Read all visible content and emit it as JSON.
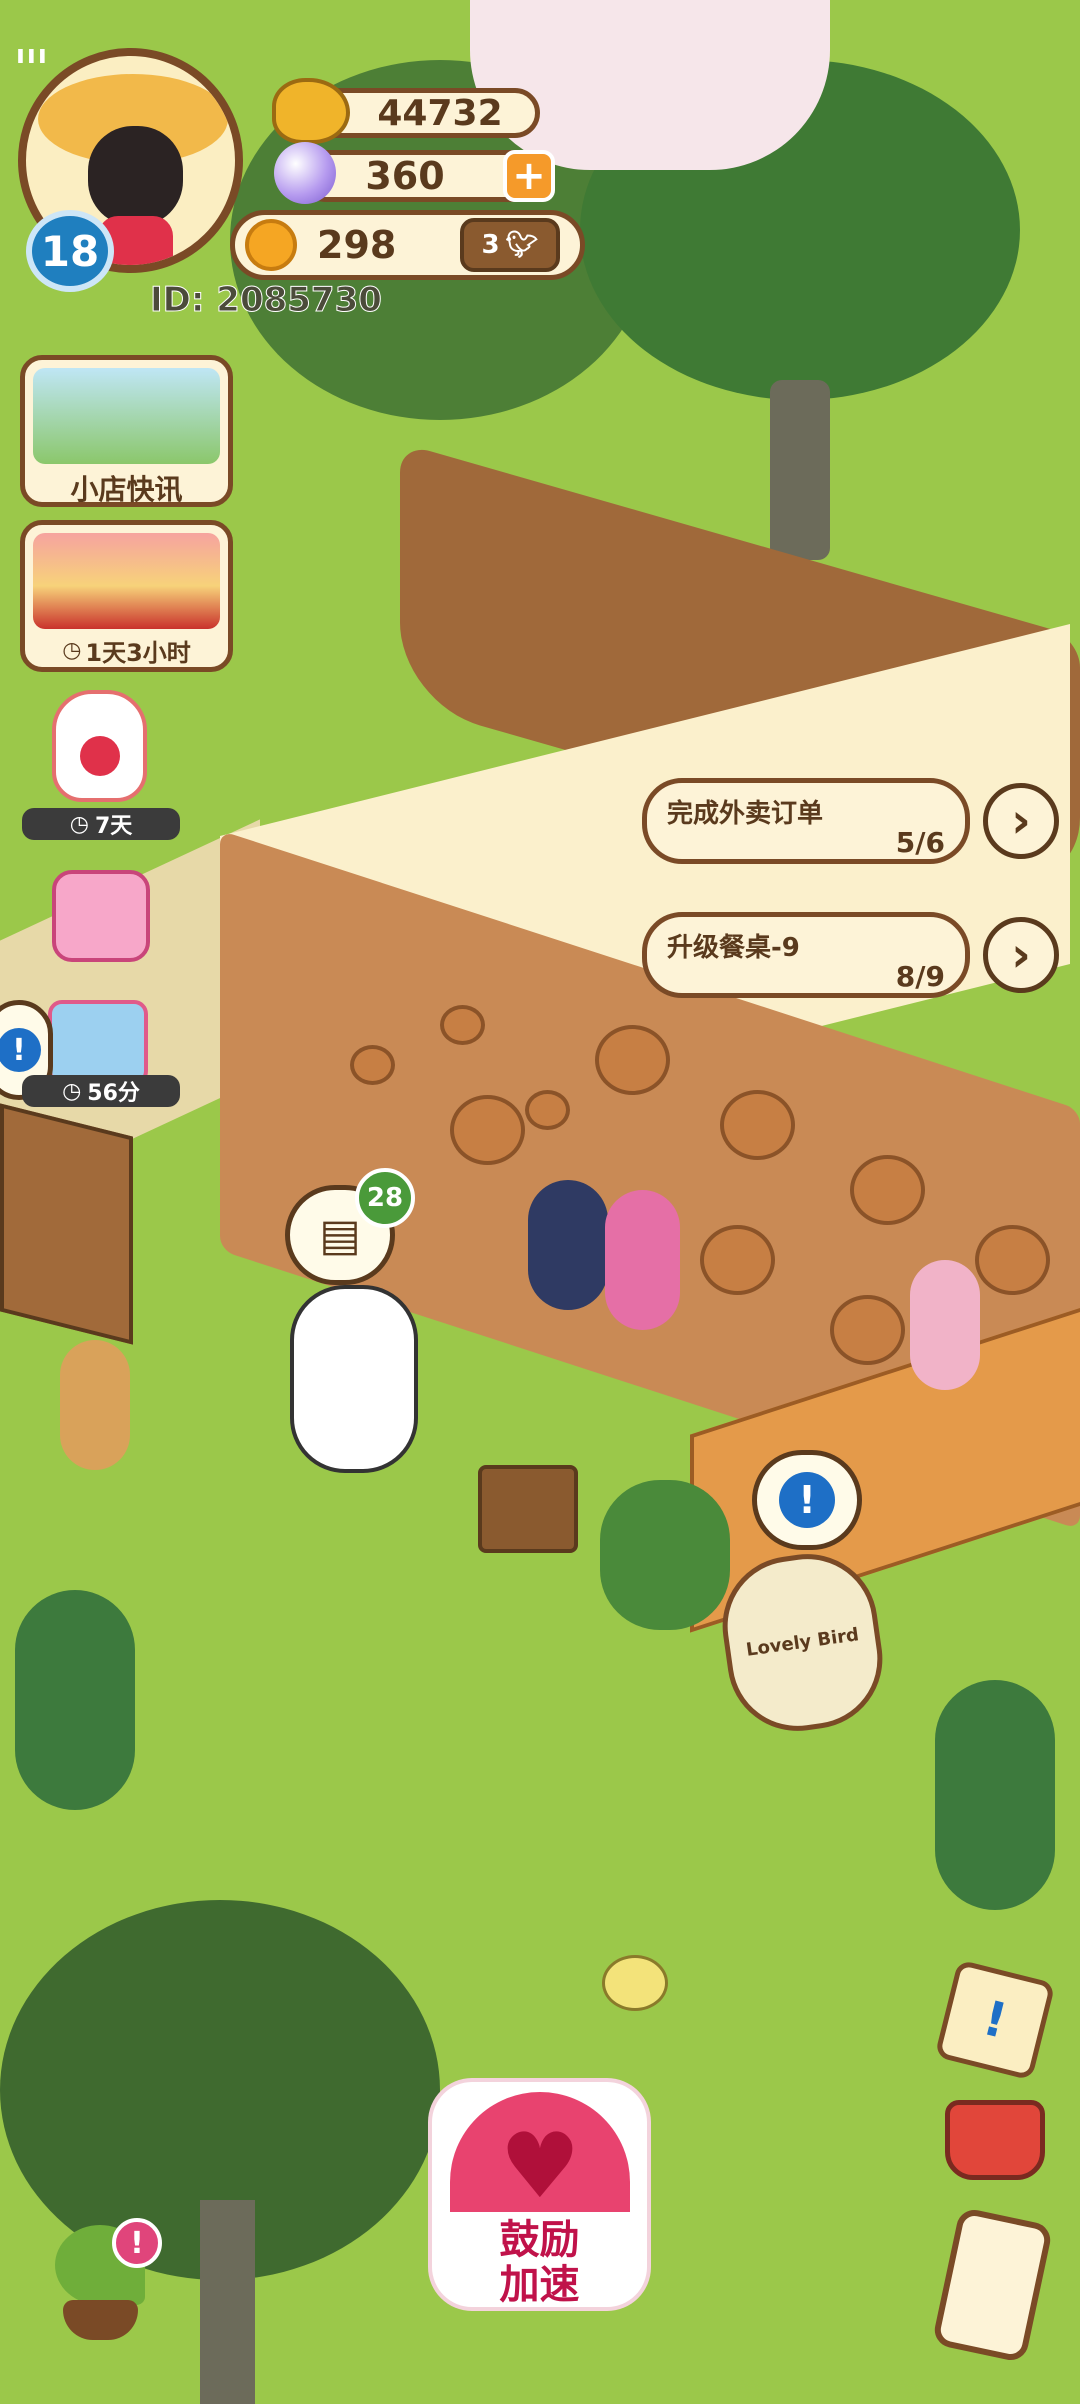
{
  "player": {
    "level": "18",
    "id_text": "ID: 2085730"
  },
  "currencies": {
    "coins": "44732",
    "gems": "360",
    "flowers": "298",
    "bird_badge": "3"
  },
  "side_menu": {
    "news_label": "小店快讯",
    "event_timer": "1天3小时",
    "rabbit_timer": "7天",
    "gift_timer": "56分"
  },
  "tasks": [
    {
      "label": "完成外卖订单",
      "progress": "5/6"
    },
    {
      "label": "升级餐桌-9",
      "progress": "8/9"
    }
  ],
  "order_bubble_count": "28",
  "sign_text": "Lovely Bird",
  "encourage_button": {
    "line1": "鼓励",
    "line2": "加速"
  },
  "status_bar_icon": "signal-icon",
  "colors": {
    "grass": "#9bc84a",
    "wood_border": "#7a4a26",
    "cream": "#fdf3d7",
    "level_badge": "#1f7fbf",
    "heart_button": "#e8436f"
  }
}
